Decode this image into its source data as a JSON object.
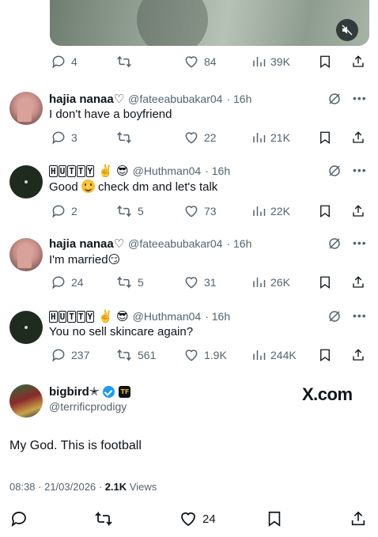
{
  "top_post": {
    "stats": {
      "replies": "4",
      "likes": "84",
      "views": "39K"
    }
  },
  "replies": [
    {
      "name": "hajia nanaa",
      "name_suffix": "♡",
      "handle": "@fateeabubakar04",
      "time": "· 16h",
      "text": "I don't have a boyfriend",
      "stats": {
        "replies": "3",
        "retweets": "",
        "likes": "22",
        "views": "21K"
      }
    },
    {
      "name_badge": [
        "H",
        "U",
        "T",
        "T",
        "Y"
      ],
      "name_emoji": "✌️ 😎",
      "handle": "@Huthman04",
      "time": "· 16h",
      "text_before": "Good ",
      "text_after": " check dm and let's talk",
      "stats": {
        "replies": "2",
        "retweets": "5",
        "likes": "73",
        "views": "22K"
      }
    },
    {
      "name": "hajia nanaa",
      "name_suffix": "♡",
      "handle": "@fateeabubakar04",
      "time": "· 16h",
      "text": "I'm married😏",
      "stats": {
        "replies": "24",
        "retweets": "5",
        "likes": "31",
        "views": "26K"
      }
    },
    {
      "name_badge": [
        "H",
        "U",
        "T",
        "T",
        "Y"
      ],
      "name_emoji": "✌️ 😎",
      "handle": "@Huthman04",
      "time": "· 16h",
      "text": "You no sell skincare again?",
      "stats": {
        "replies": "237",
        "retweets": "561",
        "likes": "1.9K",
        "views": "244K"
      }
    }
  ],
  "main_post": {
    "name": "bigbird",
    "name_suffix": "✭",
    "badge_text": "TF",
    "handle": "@terrificprodigy",
    "watermark": "X.com",
    "text": "My God. This is football",
    "time": "08:38 · 21/03/2026 · ",
    "views_count": "2.1K",
    "views_label": " Views",
    "stats": {
      "likes": "24"
    }
  },
  "colors": {
    "text": "#0f1419",
    "muted": "#536471",
    "verified": "#1d9bf0"
  }
}
